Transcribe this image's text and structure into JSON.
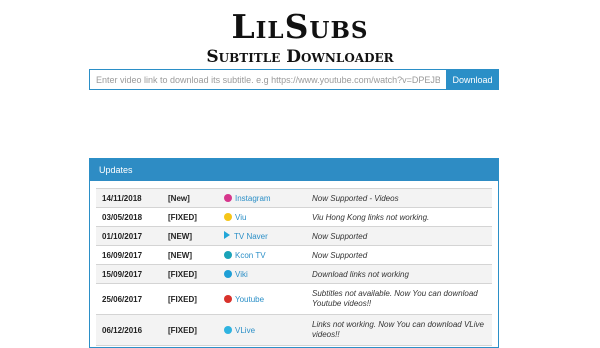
{
  "logo": {
    "title": "LilSubs",
    "subtitle": "Subtitle Downloader"
  },
  "search": {
    "placeholder": "Enter video link to download its subtitle. e.g https://www.youtube.com/watch?v=DPEJB-FCItk",
    "value": "",
    "button_label": "Download"
  },
  "updates": {
    "heading": "Updates",
    "rows": [
      {
        "date": "14/11/2018",
        "tag": "[New]",
        "site": "Instagram",
        "icon": "instagram-icon",
        "icon_color": "#d6368c",
        "note": "Now Supported - Videos"
      },
      {
        "date": "03/05/2018",
        "tag": "[FIXED]",
        "site": "Viu",
        "icon": "viu-icon",
        "icon_color": "#f5c518",
        "note": "Viu Hong Kong links not working."
      },
      {
        "date": "01/10/2017",
        "tag": "[NEW]",
        "site": "TV Naver",
        "icon": "tv-naver-icon",
        "icon_color": "#22a6d8",
        "note": "Now Supported"
      },
      {
        "date": "16/09/2017",
        "tag": "[NEW]",
        "site": "Kcon TV",
        "icon": "kcon-tv-icon",
        "icon_color": "#1aa3b8",
        "note": "Now Supported"
      },
      {
        "date": "15/09/2017",
        "tag": "[FIXED]",
        "site": "Viki",
        "icon": "viki-icon",
        "icon_color": "#1e9fd6",
        "note": "Download links not working"
      },
      {
        "date": "25/06/2017",
        "tag": "[FIXED]",
        "site": "Youtube",
        "icon": "youtube-icon",
        "icon_color": "#d8322b",
        "note": "Subtitles not available. Now You can download Youtube videos!!"
      },
      {
        "date": "06/12/2016",
        "tag": "[FIXED]",
        "site": "VLive",
        "icon": "vlive-icon",
        "icon_color": "#2fb3e0",
        "note": "Links not working. Now You can download VLive videos!!"
      }
    ]
  }
}
